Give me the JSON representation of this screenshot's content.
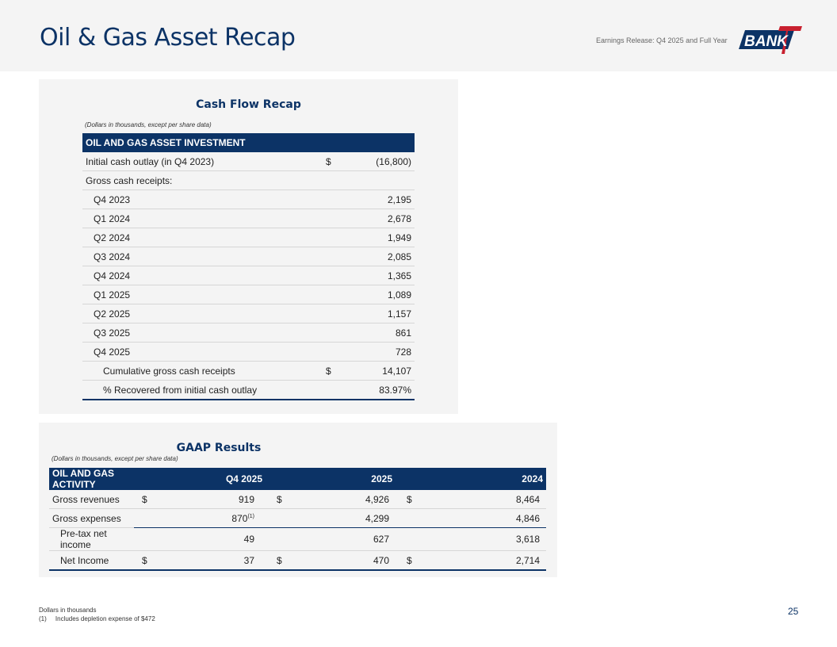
{
  "header": {
    "title": "Oil & Gas Asset Recap",
    "release": "Earnings Release: Q4 2025 and Full Year",
    "logo_text": "BANK7"
  },
  "cash_flow": {
    "title": "Cash Flow Recap",
    "note": "(Dollars in thousands, except per share data)",
    "header": "OIL AND GAS ASSET INVESTMENT",
    "initial": {
      "label": "Initial cash outlay (in Q4 2023)",
      "currency": "$",
      "value": "(16,800)"
    },
    "receipts_label": "Gross cash receipts:",
    "rows": [
      {
        "label": "Q4 2023",
        "value": "2,195"
      },
      {
        "label": "Q1 2024",
        "value": "2,678"
      },
      {
        "label": "Q2 2024",
        "value": "1,949"
      },
      {
        "label": "Q3 2024",
        "value": "2,085"
      },
      {
        "label": "Q4 2024",
        "value": "1,365"
      },
      {
        "label": "Q1 2025",
        "value": "1,089"
      },
      {
        "label": "Q2 2025",
        "value": "1,157"
      },
      {
        "label": "Q3 2025",
        "value": "861"
      },
      {
        "label": "Q4 2025",
        "value": "728"
      }
    ],
    "cumulative": {
      "label": "Cumulative gross cash receipts",
      "currency": "$",
      "value": "14,107"
    },
    "recovered": {
      "label": "% Recovered from initial cash outlay",
      "value": "83.97%"
    }
  },
  "gaap": {
    "title": "GAAP Results",
    "note": "(Dollars in thousands, except per share data)",
    "header": "OIL AND GAS ACTIVITY",
    "columns": [
      "Q4 2025",
      "2025",
      "2024"
    ],
    "rows": [
      {
        "label": "Gross revenues",
        "cur": [
          "$",
          "$",
          "$"
        ],
        "values": [
          "919",
          "4,926",
          "8,464"
        ]
      },
      {
        "label": "Gross expenses",
        "cur": [
          "",
          "",
          ""
        ],
        "values": [
          "870",
          "4,299",
          "4,846"
        ],
        "footnote": "(1)"
      },
      {
        "label": "Pre-tax net income",
        "cur": [
          "",
          "",
          ""
        ],
        "values": [
          "49",
          "627",
          "3,618"
        ]
      },
      {
        "label": "Net Income",
        "cur": [
          "$",
          "$",
          "$"
        ],
        "values": [
          "37",
          "470",
          "2,714"
        ]
      }
    ]
  },
  "footer": {
    "line1": "Dollars in thousands",
    "fn_mark": "(1)",
    "fn_text": "Includes depletion expense of $472",
    "page": "25"
  }
}
